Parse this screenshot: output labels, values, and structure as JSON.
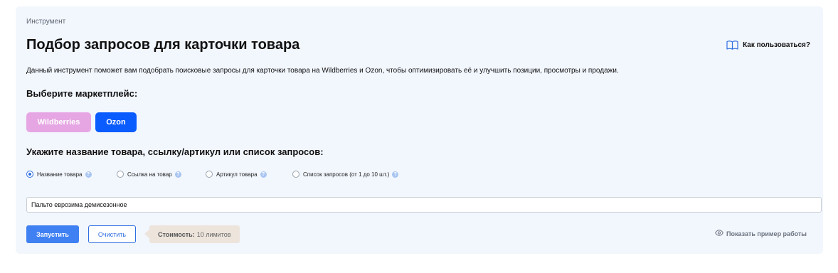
{
  "breadcrumb": "Инструмент",
  "title": "Подбор запросов для карточки товара",
  "help_link": {
    "label": "Как пользоваться?",
    "icon": "book-icon"
  },
  "description": "Данный инструмент поможет вам подобрать поисковые запросы для карточки товара на Wildberries и Ozon, чтобы оптимизировать её и улучшить позиции, просмотры и продажи.",
  "marketplace": {
    "heading": "Выберите маркетплейс:",
    "options": [
      {
        "label": "Wildberries",
        "color": "#e6a6e3",
        "selected": false
      },
      {
        "label": "Ozon",
        "color": "#0a5cff",
        "selected": true
      }
    ]
  },
  "query_type": {
    "heading": "Укажите название товара, ссылку/артикул или список запросов:",
    "options": [
      {
        "label": "Название товара",
        "checked": true
      },
      {
        "label": "Ссылка на товар",
        "checked": false
      },
      {
        "label": "Артикул товара",
        "checked": false
      },
      {
        "label": "Список запросов (от 1 до 10 шт.)",
        "checked": false
      }
    ]
  },
  "input": {
    "value": "Пальто еврозима демисезонное"
  },
  "actions": {
    "run_label": "Запустить",
    "clear_label": "Очистить",
    "cost_label": "Стоимость:",
    "cost_value": "10 лимитов"
  },
  "example_link": {
    "label": "Показать пример работы",
    "icon": "eye-icon"
  },
  "colors": {
    "accent": "#3f80f2",
    "card_bg": "#f2f6fd",
    "ozon": "#0a5cff",
    "wildberries": "#e6a6e3"
  }
}
